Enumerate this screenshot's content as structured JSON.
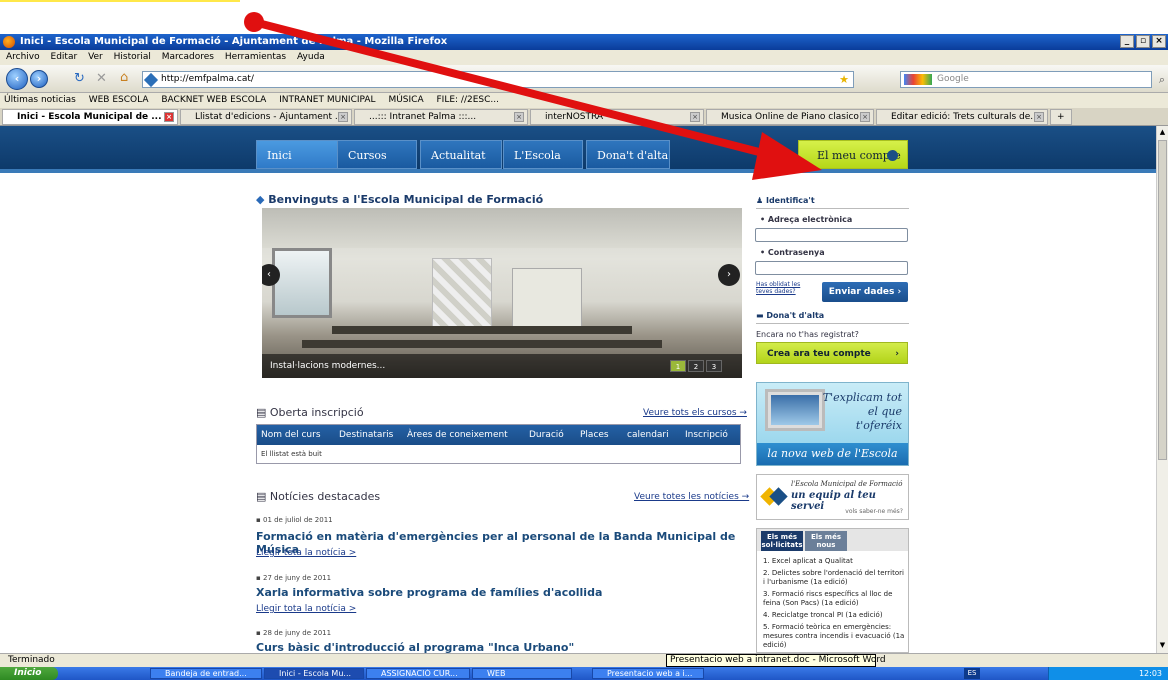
{
  "window": {
    "title": "Inici - Escola Municipal de Formació - Ajuntament de Palma - Mozilla Firefox"
  },
  "menu": [
    "Archivo",
    "Editar",
    "Ver",
    "Historial",
    "Marcadores",
    "Herramientas",
    "Ayuda"
  ],
  "nav": {
    "url": "http://emfpalma.cat/",
    "search_placeholder": "Google"
  },
  "bookmarks": [
    "Últimas noticias",
    "WEB ESCOLA",
    "BACKNET WEB ESCOLA",
    "INTRANET MUNICIPAL",
    "MÚSICA",
    "FILE: //2ESC..."
  ],
  "tabs": [
    {
      "label": "Inici - Escola Municipal de ..."
    },
    {
      "label": "Llistat d'edicions - Ajuntament ..."
    },
    {
      "label": "...::: Intranet Palma :::..."
    },
    {
      "label": "interNOSTRA"
    },
    {
      "label": "Musica Online de Piano clasico ..."
    },
    {
      "label": "Editar edició: Trets culturals de..."
    }
  ],
  "site": {
    "tabs": [
      "Inici",
      "Cursos",
      "Actualitat",
      "L'Escola",
      "Dona't d'alta"
    ],
    "account": "El meu compte",
    "welcome": "Benvinguts a l'Escola Municipal de Formació",
    "slide_caption": "Instal·lacions modernes...",
    "slide_pages": [
      "1",
      "2",
      "3"
    ],
    "inscription": {
      "title": "Oberta inscripció",
      "link": "Veure tots els cursos →",
      "columns": [
        "Nom del curs",
        "Destinataris",
        "Àrees de coneixement",
        "Duració",
        "Places",
        "calendari",
        "Inscripció"
      ],
      "empty": "El llistat està buit"
    },
    "news": {
      "title": "Notícies destacades",
      "link": "Veure totes les notícies →",
      "items": [
        {
          "date": "01 de juliol de 2011",
          "title": "Formació en matèria d'emergències per al personal de la Banda Municipal de Música",
          "more": "Llegir tota la notícia >"
        },
        {
          "date": "27 de juny de 2011",
          "title": "Xarla informativa sobre programa de famílies d'acollida",
          "more": "Llegir tota la notícia >"
        },
        {
          "date": "28 de juny de 2011",
          "title": "Curs bàsic d'introducció al programa \"Inca Urbano\"",
          "more": ""
        }
      ]
    },
    "login": {
      "heading": "Identifica't",
      "email_label": "Adreça electrònica",
      "password_label": "Contrasenya",
      "forgot": "Has oblidat les teves dades?",
      "send": "Enviar dades"
    },
    "signup": {
      "heading": "Dona't d'alta",
      "question": "Encara no t'has registrat?",
      "button": "Crea ara teu compte"
    },
    "promo1": {
      "text": "T'explicam tot el que t'oferéix",
      "bar": "la nova web de l'Escola"
    },
    "promo2": {
      "line1": "l'Escola Municipal de Formació",
      "line2": "un equip al teu servei",
      "line3": "vols saber-ne més?"
    },
    "tops": {
      "tabs": [
        "Els més sol·licitats",
        "Els més nous"
      ],
      "items": [
        "1. Excel aplicat a Qualitat",
        "2. Delictes sobre l'ordenació del territori i l'urbanisme (1a edició)",
        "3. Formació riscs específics al lloc de feina (Son Pacs) (1a edició)",
        "4. Reciclatge troncal PI (1a edició)",
        "5. Formació teòrica en emergències: mesures contra incendis i evacuació (1a edició)"
      ]
    }
  },
  "status": {
    "text": "Terminado",
    "tooltip": "Presentacio web a intranet.doc - Microsoft Word"
  },
  "taskbar": {
    "start": "Inicio",
    "tasks": [
      "Bandeja de entrad...",
      "Inici - Escola Mu...",
      "ASSIGNACIÓ CUR...",
      "WEB",
      "Presentacio web a i..."
    ],
    "clock": "12:03",
    "lang": "ES"
  }
}
